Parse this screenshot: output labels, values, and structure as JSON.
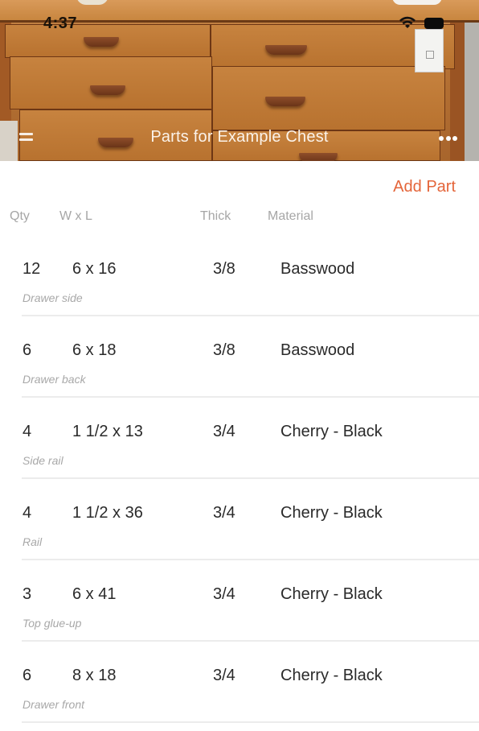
{
  "status_bar": {
    "time": "4:37",
    "wifi_icon": "wifi-icon",
    "battery_icon": "battery-icon"
  },
  "nav": {
    "title": "Parts for Example Chest",
    "menu_icon": "menu-icon",
    "more_icon": "more-icon"
  },
  "toolbar": {
    "add_part_label": "Add Part"
  },
  "colors": {
    "accent": "#e4653a",
    "header_text": "#a6a6a6",
    "note_text": "#a8a8a8"
  },
  "table": {
    "headers": {
      "qty": "Qty",
      "wl": "W x L",
      "thick": "Thick",
      "material": "Material"
    },
    "rows": [
      {
        "qty": "12",
        "wl": "6 x 16",
        "thick": "3/8",
        "material": "Basswood",
        "note": "Drawer side"
      },
      {
        "qty": "6",
        "wl": "6 x 18",
        "thick": "3/8",
        "material": "Basswood",
        "note": "Drawer back"
      },
      {
        "qty": "4",
        "wl": "1 1/2 x 13",
        "thick": "3/4",
        "material": "Cherry - Black",
        "note": "Side rail"
      },
      {
        "qty": "4",
        "wl": "1 1/2 x 36",
        "thick": "3/4",
        "material": "Cherry - Black",
        "note": "Rail"
      },
      {
        "qty": "3",
        "wl": "6 x 41",
        "thick": "3/4",
        "material": "Cherry - Black",
        "note": "Top glue-up"
      },
      {
        "qty": "6",
        "wl": "8 x 18",
        "thick": "3/4",
        "material": "Cherry - Black",
        "note": "Drawer front"
      }
    ]
  }
}
